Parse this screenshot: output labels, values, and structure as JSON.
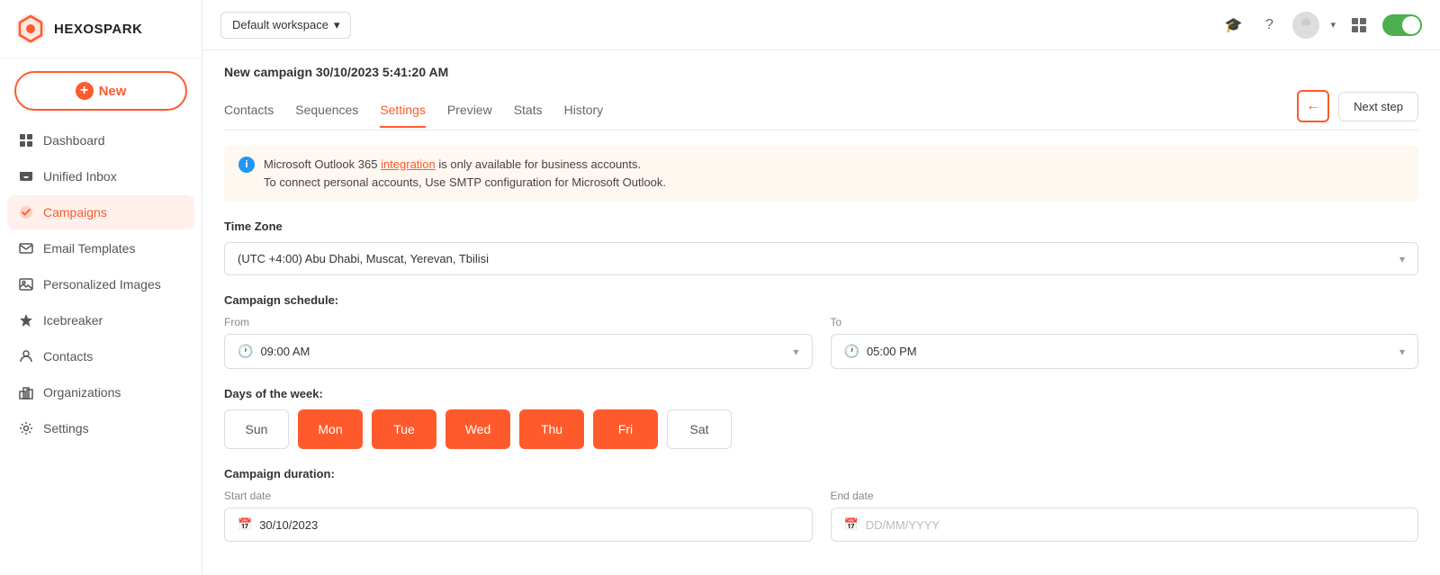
{
  "logo": {
    "text": "HEXOSPARK"
  },
  "workspace": {
    "label": "Default workspace"
  },
  "new_button": {
    "label": "New"
  },
  "nav": {
    "items": [
      {
        "id": "dashboard",
        "label": "Dashboard",
        "icon": "grid"
      },
      {
        "id": "unified-inbox",
        "label": "Unified Inbox",
        "icon": "inbox"
      },
      {
        "id": "campaigns",
        "label": "Campaigns",
        "icon": "campaigns",
        "active": true
      },
      {
        "id": "email-templates",
        "label": "Email Templates",
        "icon": "email"
      },
      {
        "id": "personalized-images",
        "label": "Personalized Images",
        "icon": "image"
      },
      {
        "id": "icebreaker",
        "label": "Icebreaker",
        "icon": "ice"
      },
      {
        "id": "contacts",
        "label": "Contacts",
        "icon": "contacts"
      },
      {
        "id": "organizations",
        "label": "Organizations",
        "icon": "org"
      },
      {
        "id": "settings",
        "label": "Settings",
        "icon": "gear"
      }
    ]
  },
  "campaign": {
    "title": "New campaign 30/10/2023 5:41:20 AM",
    "tabs": [
      {
        "id": "contacts",
        "label": "Contacts"
      },
      {
        "id": "sequences",
        "label": "Sequences"
      },
      {
        "id": "settings",
        "label": "Settings",
        "active": true
      },
      {
        "id": "preview",
        "label": "Preview"
      },
      {
        "id": "stats",
        "label": "Stats"
      },
      {
        "id": "history",
        "label": "History"
      }
    ],
    "next_step_label": "Next step"
  },
  "info_banner": {
    "line1_prefix": "Microsoft Outlook 365 ",
    "link_text": "integration",
    "line1_suffix": " is only available for business accounts.",
    "line2": "To connect personal accounts, Use SMTP configuration for Microsoft Outlook."
  },
  "timezone": {
    "label": "Time Zone",
    "value": "(UTC +4:00) Abu Dhabi, Muscat, Yerevan, Tbilisi"
  },
  "schedule": {
    "label": "Campaign schedule:",
    "from_label": "From",
    "from_value": "09:00 AM",
    "to_label": "To",
    "to_value": "05:00 PM"
  },
  "days": {
    "label": "Days of the week:",
    "items": [
      {
        "id": "sun",
        "label": "Sun",
        "active": false
      },
      {
        "id": "mon",
        "label": "Mon",
        "active": true
      },
      {
        "id": "tue",
        "label": "Tue",
        "active": true
      },
      {
        "id": "wed",
        "label": "Wed",
        "active": true
      },
      {
        "id": "thu",
        "label": "Thu",
        "active": true
      },
      {
        "id": "fri",
        "label": "Fri",
        "active": true
      },
      {
        "id": "sat",
        "label": "Sat",
        "active": false
      }
    ]
  },
  "duration": {
    "label": "Campaign duration:",
    "start_label": "Start date",
    "start_value": "30/10/2023",
    "end_label": "End date",
    "end_placeholder": "DD/MM/YYYY"
  }
}
